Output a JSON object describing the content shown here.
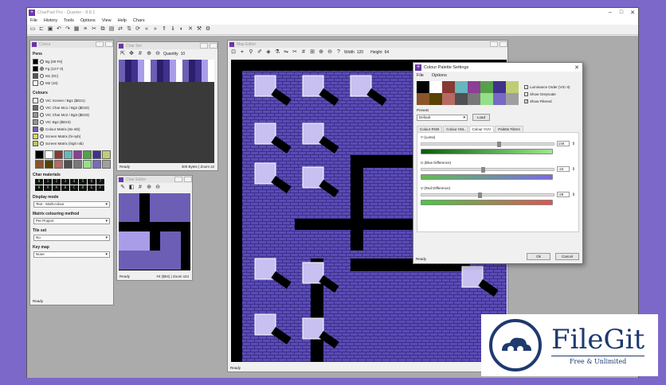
{
  "app": {
    "title": "CharPad Pro - Quarter - 8.8.1"
  },
  "menu": [
    "File",
    "History",
    "Tools",
    "Options",
    "View",
    "Help",
    "Chars"
  ],
  "colours_panel": {
    "title": "Colour",
    "pens_header": "Pens",
    "pens": [
      {
        "label": "Bg (00 F0)",
        "color": "#000000",
        "selected": false
      },
      {
        "label": "Fg (13 F 0)",
        "color": "#000000",
        "selected": true
      },
      {
        "label": "M1 (0C)",
        "color": "#555555",
        "selected": false
      },
      {
        "label": "M2 (10)",
        "color": "#ffffff",
        "selected": false
      }
    ],
    "colours_header": "Colours",
    "colours": [
      {
        "label": "VIC Screen / Bg1 ($D21)",
        "color": "#ffffff"
      },
      {
        "label": "VIC Char Mc1 / Bg2 ($D22)",
        "color": "#6c6c6c"
      },
      {
        "label": "VIC Char Mc2 / Bg3 ($D23)",
        "color": "#959595"
      },
      {
        "label": "VIC Bg4 ($D24)",
        "color": "#959595"
      },
      {
        "label": "Colour Matrix (8x-ntb)",
        "color": "#6c5eb5"
      },
      {
        "label": "Screen Matrix (hi-nyb)",
        "color": "#d8d860"
      },
      {
        "label": "Screen Matrix (high nib)",
        "color": "#b8c860"
      }
    ],
    "palette": [
      "#000000",
      "#ffffff",
      "#883932",
      "#67b6bd",
      "#8b3f96",
      "#55a049",
      "#40318d",
      "#bfce72",
      "#8b5429",
      "#574200",
      "#b86962",
      "#505050",
      "#787878",
      "#94e089",
      "#7869c4",
      "#9f9f9f"
    ],
    "char_materials_header": "Char materials",
    "char_materials": [
      "0",
      "1",
      "2",
      "3",
      "4",
      "5",
      "6",
      "7",
      "8",
      "9",
      "A",
      "B",
      "C",
      "D",
      "E",
      "F"
    ],
    "display_mode_label": "Display mode",
    "display_mode": "Text - Multi-colour",
    "matrix_method_label": "Matrix colouring method",
    "matrix_method": "Per Project",
    "tile_set_label": "Tile set",
    "tile_set": "No",
    "key_map_label": "Key map",
    "key_map": "None",
    "status": "Ready"
  },
  "char_set_panel": {
    "title": "Char Set",
    "quantity_label": "Quantity",
    "quantity": "10",
    "status_left": "Ready",
    "status_right": "400 Bytes | Zoom x2"
  },
  "char_editor_panel": {
    "title": "Char Editor",
    "status_left": "Ready",
    "status_right": "#4 ($04) | Zoom x24"
  },
  "map_panel": {
    "title": "Map Editor",
    "width_label": "Width",
    "width": "120",
    "height_label": "Height",
    "height": "64",
    "status_left": "Ready",
    "status_right": "6192 Cells"
  },
  "dialog": {
    "title": "Colour Palette Settings",
    "menu": [
      "File",
      "Options"
    ],
    "swatches": [
      "#000000",
      "#ffffff",
      "#883932",
      "#67b6bd",
      "#8b3f96",
      "#55a049",
      "#40318d",
      "#bfce72",
      "#8b5429",
      "#574200",
      "#b86962",
      "#505050",
      "#787878",
      "#94e089",
      "#7869c4",
      "#9f9f9f"
    ],
    "options": [
      {
        "label": "Luminance Order (VIC-II)",
        "checked": false
      },
      {
        "label": "Show Greyscale",
        "checked": false
      },
      {
        "label": "Show Filtered",
        "checked": true
      }
    ],
    "presets_label": "Presets",
    "preset": "Default",
    "load_label": "Load",
    "tabs": [
      "Colour RGB",
      "Colour HSL",
      "Colour YUV",
      "Palette Filters"
    ],
    "active_tab": 2,
    "sliders": [
      {
        "label": "Y (Luma)",
        "value": "146",
        "fill": 0.57
      },
      {
        "label": "U (Blue Difference)",
        "value": "-34",
        "fill": 0.45
      },
      {
        "label": "V (Red Difference)",
        "value": "-28",
        "fill": 0.43
      }
    ],
    "status": "Ready",
    "ok_label": "Ok",
    "cancel_label": "Cancel"
  },
  "watermark": {
    "name": "FileGit",
    "tagline": "Free & Unlimited"
  }
}
